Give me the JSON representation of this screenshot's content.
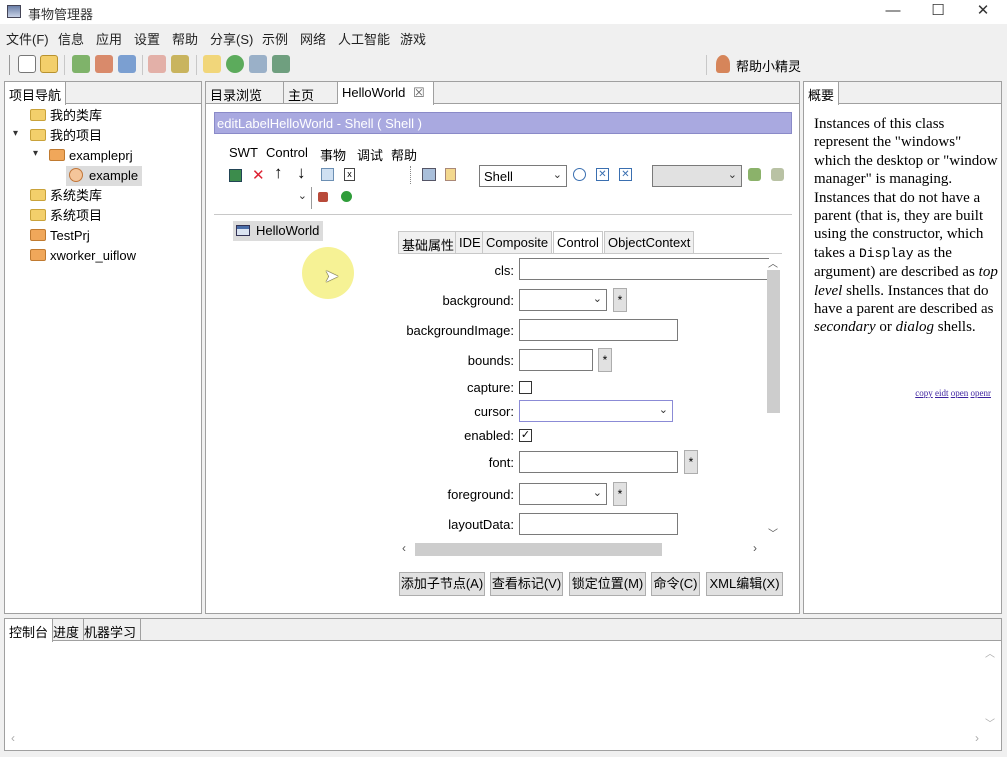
{
  "window": {
    "title": "事物管理器",
    "min": "—",
    "max": "☐",
    "close": "✕"
  },
  "menu": [
    "文件(F)",
    "信息",
    "应用",
    "设置",
    "帮助",
    "分享(S)",
    "示例",
    "网络",
    "人工智能",
    "游戏"
  ],
  "toolbar": {
    "helper_label": "帮助小精灵"
  },
  "nav": {
    "tab_label": "项目导航",
    "items": [
      "我的类库",
      "我的项目",
      "exampleprj",
      "example",
      "系统类库",
      "系统项目",
      "TestPrj",
      "xworker_uiflow"
    ]
  },
  "editor": {
    "tabs": [
      "目录浏览",
      "主页",
      "HelloWorld"
    ],
    "close_glyph": "☒",
    "banner": "editLabelHelloWorld - Shell ( Shell )",
    "inner_menu": [
      "SWT",
      "Control",
      "事物",
      "调试",
      "帮助"
    ],
    "class_combo": "Shell",
    "tree_node": "HelloWorld",
    "prop_tabs": [
      "基础属性",
      "IDE",
      "Composite",
      "Control",
      "ObjectContext"
    ],
    "props": {
      "cls": "cls:",
      "background": "background:",
      "backgroundImage": "backgroundImage:",
      "bounds": "bounds:",
      "capture": "capture:",
      "cursor": "cursor:",
      "enabled": "enabled:",
      "font": "font:",
      "foreground": "foreground:",
      "layoutData": "layoutData:"
    },
    "star": "*",
    "enabled_checked": "✓",
    "buttons": [
      "添加子节点(A)",
      "查看标记(V)",
      "锁定位置(M)",
      "命令(C)",
      "XML编辑(X)"
    ]
  },
  "summary": {
    "tab_label": "概要",
    "text_1": "Instances of this class represent the \"windows\" which the desktop or \"window manager\" is managing. Instances that do not have a parent (that is, they are built using the constructor, which takes a",
    "code": "Display",
    "text_2": "as the argument) are described as",
    "em_1": "top level",
    "text_3": "shells. Instances that do have a parent are described as",
    "em_2": "secondary",
    "text_4": "or",
    "em_3": "dialog",
    "text_5": "shells.",
    "links": [
      "copy",
      "eidt",
      "open",
      "openr"
    ]
  },
  "console": {
    "tabs": [
      "控制台",
      "进度",
      "机器学习"
    ]
  }
}
